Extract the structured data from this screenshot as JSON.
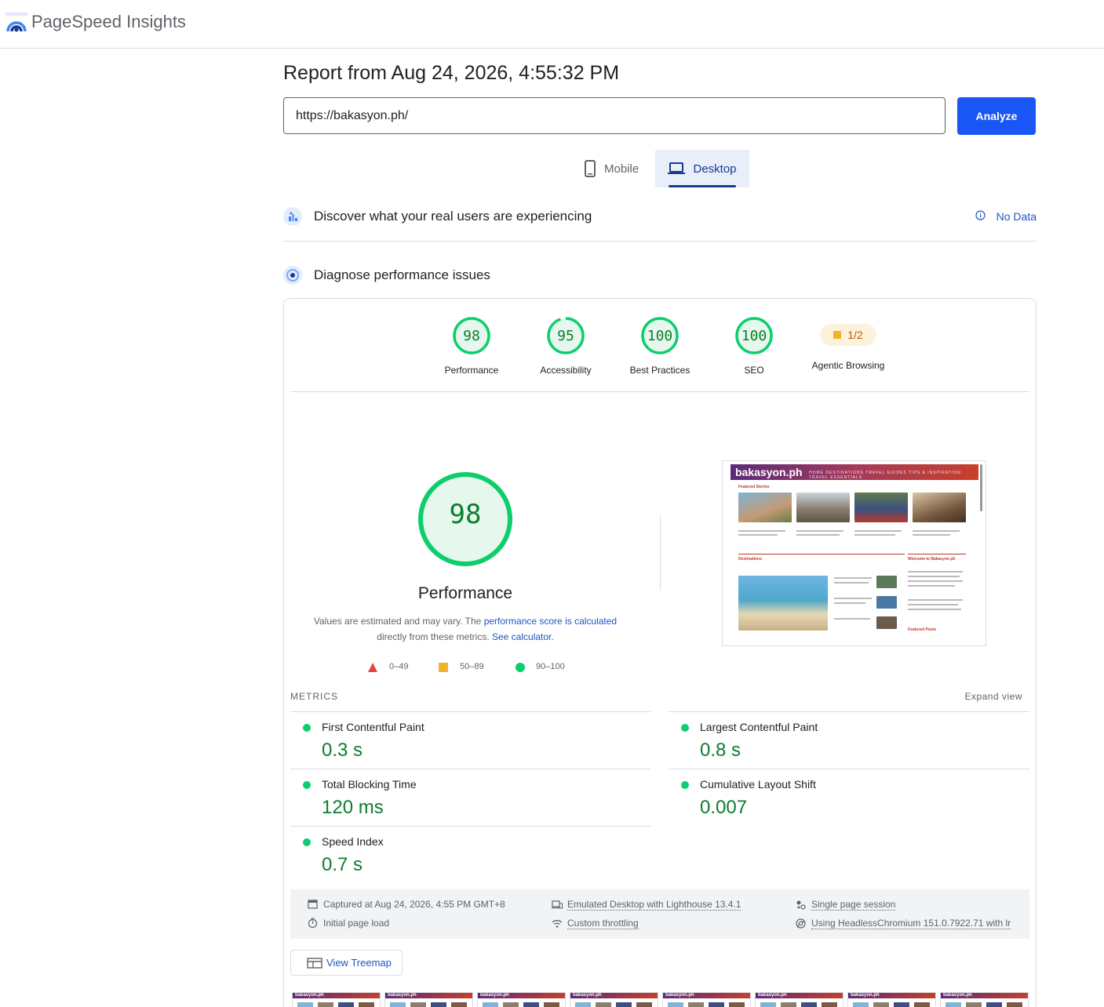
{
  "app": {
    "title": "PageSpeed Insights"
  },
  "report": {
    "title": "Report from Aug 24, 2026, 4:55:32 PM",
    "url": "https://bakasyon.ph/",
    "analyze_label": "Analyze"
  },
  "tabs": [
    {
      "label": "Mobile",
      "icon": "phone-icon",
      "selected": false
    },
    {
      "label": "Desktop",
      "icon": "laptop-icon",
      "selected": true
    }
  ],
  "sections": {
    "field_data": {
      "title": "Discover what your real users are experiencing",
      "status": "No Data"
    },
    "lab_data": {
      "title": "Diagnose performance issues"
    }
  },
  "scores": [
    {
      "label": "Performance",
      "value": "98"
    },
    {
      "label": "Accessibility",
      "value": "95"
    },
    {
      "label": "Best Practices",
      "value": "100"
    },
    {
      "label": "SEO",
      "value": "100"
    },
    {
      "label": "Agentic Browsing",
      "value": "1/2"
    }
  ],
  "performance": {
    "score": "98",
    "title": "Performance",
    "disclaimer_prefix": "Values are estimated and may vary. The",
    "disclaimer_link1": "performance score is calculated",
    "disclaimer_mid": "directly from these metrics.",
    "disclaimer_link2": "See calculator."
  },
  "legend": [
    {
      "range": "0–49",
      "color": "#e8453c",
      "shape": "triangle"
    },
    {
      "range": "50–89",
      "color": "#f2b12e",
      "shape": "square"
    },
    {
      "range": "90–100",
      "color": "#0cce6b",
      "shape": "circle"
    }
  ],
  "screenshot": {
    "brand": "bakasyon.ph",
    "nav": "HOME  DESTINATIONS  TRAVEL GUIDES  TIPS & INSPIRATION  TRAVEL ESSENTIALS",
    "featured_label": "Featured Stories",
    "destinations_label": "Destinations",
    "welcome_label": "Welcome to Bakasyon.ph",
    "featured_posts_label": "Featured Posts"
  },
  "metrics": {
    "heading": "METRICS",
    "expand_label": "Expand view",
    "items": [
      {
        "name": "First Contentful Paint",
        "value": "0.3 s"
      },
      {
        "name": "Largest Contentful Paint",
        "value": "0.8 s"
      },
      {
        "name": "Total Blocking Time",
        "value": "120 ms"
      },
      {
        "name": "Cumulative Layout Shift",
        "value": "0.007"
      },
      {
        "name": "Speed Index",
        "value": "0.7 s"
      }
    ]
  },
  "run_info": {
    "captured": "Captured at Aug 24, 2026, 4:55 PM GMT+8",
    "page_load": "Initial page load",
    "device": "Emulated Desktop with Lighthouse 13.4.1",
    "throttling": "Custom throttling",
    "session": "Single page session",
    "browser": "Using HeadlessChromium 151.0.7922.71 with lr"
  },
  "treemap_label": "View Treemap",
  "colors": {
    "accent": "#1a56f6",
    "pass": "#0cce6b",
    "pass_text": "#0c7d2c",
    "link": "#1a56c6"
  }
}
